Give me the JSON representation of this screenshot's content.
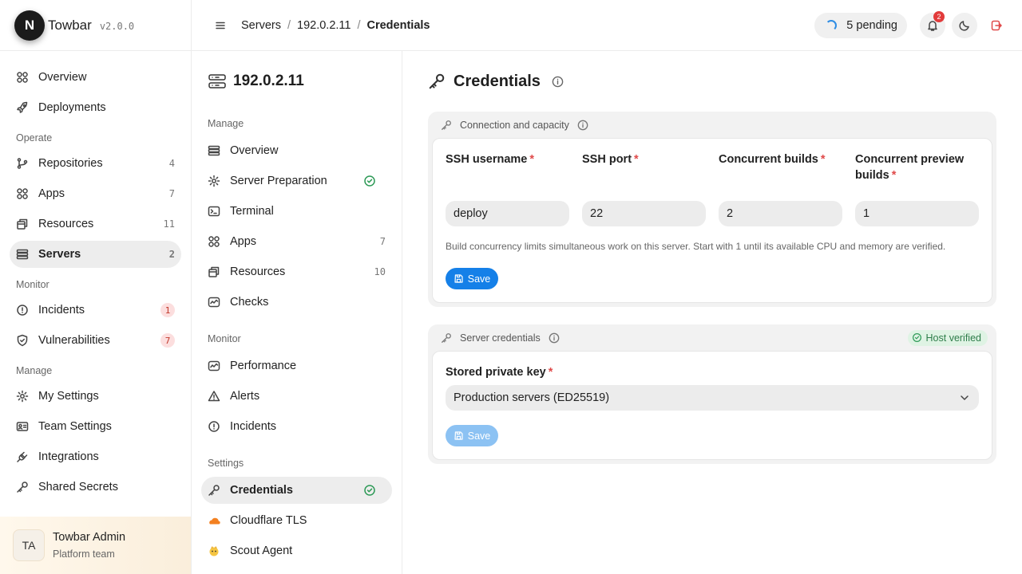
{
  "brand": {
    "logo_letter": "N",
    "name": "Towbar",
    "version": "v2.0.0"
  },
  "sidebar": {
    "items_top": [
      {
        "label": "Overview",
        "icon": "grid-icon"
      },
      {
        "label": "Deployments",
        "icon": "rocket-icon"
      }
    ],
    "operate_label": "Operate",
    "operate": [
      {
        "label": "Repositories",
        "count": "4",
        "icon": "git-branch-icon"
      },
      {
        "label": "Apps",
        "count": "7",
        "icon": "grid-icon"
      },
      {
        "label": "Resources",
        "count": "11",
        "icon": "boxes-icon"
      },
      {
        "label": "Servers",
        "count": "2",
        "icon": "server-icon"
      }
    ],
    "monitor_label": "Monitor",
    "monitor": [
      {
        "label": "Incidents",
        "count": "1",
        "icon": "alert-circle-icon"
      },
      {
        "label": "Vulnerabilities",
        "count": "7",
        "icon": "shield-icon"
      }
    ],
    "manage_label": "Manage",
    "manage": [
      {
        "label": "My Settings",
        "icon": "gear-icon"
      },
      {
        "label": "Team Settings",
        "icon": "id-card-icon"
      },
      {
        "label": "Integrations",
        "icon": "plug-icon"
      },
      {
        "label": "Shared Secrets",
        "icon": "key-icon"
      }
    ],
    "user": {
      "initials": "TA",
      "name": "Towbar Admin",
      "team": "Platform team"
    }
  },
  "topbar": {
    "breadcrumbs": [
      "Servers",
      "192.0.2.11",
      "Credentials"
    ],
    "pending": "5 pending",
    "notifications": "2"
  },
  "subnav": {
    "title": "192.0.2.11",
    "manage_label": "Manage",
    "manage": [
      {
        "label": "Overview"
      },
      {
        "label": "Server Preparation"
      },
      {
        "label": "Terminal"
      },
      {
        "label": "Apps",
        "count": "7"
      },
      {
        "label": "Resources",
        "count": "10"
      },
      {
        "label": "Checks"
      }
    ],
    "monitor_label": "Monitor",
    "monitor": [
      {
        "label": "Performance"
      },
      {
        "label": "Alerts"
      },
      {
        "label": "Incidents"
      }
    ],
    "settings_label": "Settings",
    "settings": [
      {
        "label": "Credentials"
      },
      {
        "label": "Cloudflare TLS"
      },
      {
        "label": "Scout Agent"
      }
    ]
  },
  "main": {
    "title": "Credentials",
    "connection": {
      "heading": "Connection and capacity",
      "fields": [
        {
          "label": "SSH username",
          "value": "deploy"
        },
        {
          "label": "SSH port",
          "value": "22"
        },
        {
          "label": "Concurrent builds",
          "value": "2"
        },
        {
          "label": "Concurrent preview builds",
          "value": "1"
        }
      ],
      "hint": "Build concurrency limits simultaneous work on this server. Start with 1 until its available CPU and memory are verified.",
      "save": "Save"
    },
    "credentials": {
      "heading": "Server credentials",
      "status": "Host verified",
      "key_label": "Stored private key",
      "key_value": "Production servers (ED25519)",
      "save": "Save"
    }
  },
  "colors": {
    "accent": "#1580e8",
    "success": "#2e9a57",
    "danger": "#e23b3b"
  }
}
